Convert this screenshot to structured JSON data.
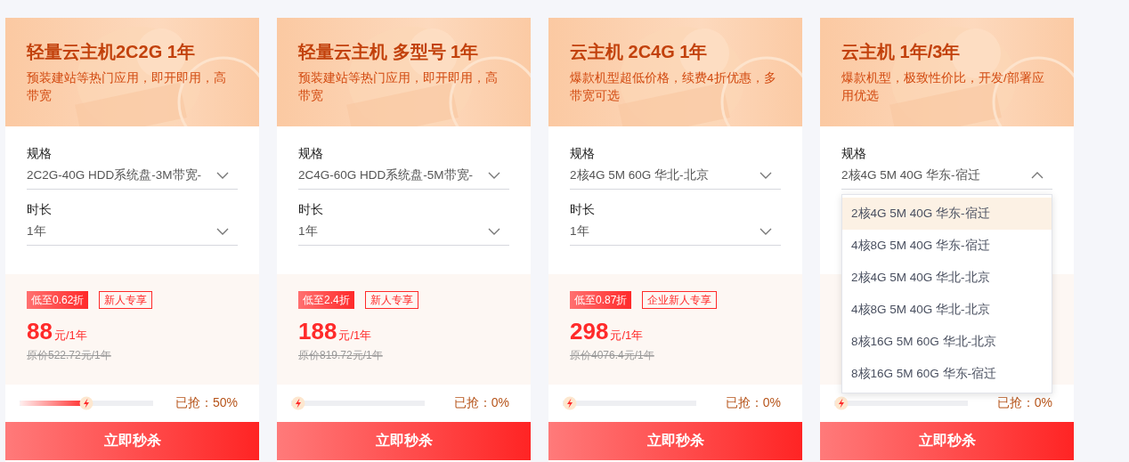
{
  "cards": [
    {
      "title": "轻量云主机2C2G 1年",
      "description": "预装建站等热门应用，即开即用，高带宽",
      "spec": {
        "label": "规格",
        "value": "2C2G-40G HDD系统盘-3M带宽-",
        "expanded": false
      },
      "duration": {
        "label": "时长",
        "value": "1年",
        "expanded": false
      },
      "discount_tag": "低至0.62折",
      "promo_tag": "新人专享",
      "price": "88",
      "price_unit": "元/1年",
      "original_price": "原价522.72元/1年",
      "progress": {
        "level": 0.5,
        "label": "已抢：50%"
      },
      "button": "立即秒杀"
    },
    {
      "title": "轻量云主机 多型号 1年",
      "description": "预装建站等热门应用，即开即用，高带宽",
      "spec": {
        "label": "规格",
        "value": "2C4G-60G HDD系统盘-5M带宽-",
        "expanded": false
      },
      "duration": {
        "label": "时长",
        "value": "1年",
        "expanded": false
      },
      "discount_tag": "低至2.4折",
      "promo_tag": "新人专享",
      "price": "188",
      "price_unit": "元/1年",
      "original_price": "原价819.72元/1年",
      "progress": {
        "level": 0,
        "label": "已抢：0%"
      },
      "button": "立即秒杀"
    },
    {
      "title": "云主机 2C4G 1年",
      "description": "爆款机型超低价格，续费4折优惠，多带宽可选",
      "spec": {
        "label": "规格",
        "value": "2核4G 5M 60G 华北-北京",
        "expanded": false
      },
      "duration": {
        "label": "时长",
        "value": "1年",
        "expanded": false
      },
      "discount_tag": "低至0.87折",
      "promo_tag": "企业新人专享",
      "price": "298",
      "price_unit": "元/1年",
      "original_price": "原价4076.4元/1年",
      "progress": {
        "level": 0,
        "label": "已抢：0%"
      },
      "button": "立即秒杀"
    },
    {
      "title": "云主机 1年/3年",
      "description": "爆款机型，极致性价比，开发/部署应用优选",
      "spec": {
        "label": "规格",
        "value": "2核4G 5M 40G 华东-宿迁",
        "expanded": true,
        "options": [
          {
            "label": "2核4G 5M 40G 华东-宿迁",
            "selected": true
          },
          {
            "label": "4核8G 5M 40G 华东-宿迁",
            "selected": false
          },
          {
            "label": "2核4G 5M 40G 华北-北京",
            "selected": false
          },
          {
            "label": "4核8G 5M 40G 华北-北京",
            "selected": false
          },
          {
            "label": "8核16G 5M 60G 华北-北京",
            "selected": false
          },
          {
            "label": "8核16G 5M 60G 华东-宿迁",
            "selected": false
          }
        ]
      },
      "progress": {
        "level": 0,
        "label": "已抢：0%"
      },
      "button": "立即秒杀"
    }
  ]
}
